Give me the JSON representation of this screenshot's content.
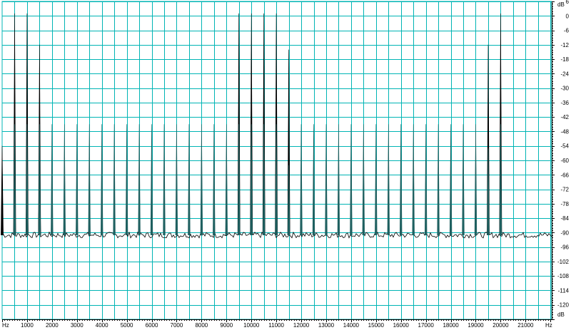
{
  "colors": {
    "grid": "#00b4b4",
    "trace": "#000000",
    "peak_fill": "#1f6060",
    "background": "#ffffff"
  },
  "chart_data": {
    "type": "line",
    "title": "",
    "xlabel": "",
    "ylabel": "",
    "x_unit": "Hz",
    "y_unit": "dB",
    "xlim": [
      0,
      22050
    ],
    "ylim": [
      -126,
      6
    ],
    "grid": true,
    "x_ticks": [
      1000,
      2000,
      3000,
      4000,
      5000,
      6000,
      7000,
      8000,
      9000,
      10000,
      11000,
      12000,
      13000,
      14000,
      15000,
      16000,
      17000,
      18000,
      19000,
      20000,
      21000
    ],
    "y_ticks": [
      6,
      0,
      -6,
      -12,
      -18,
      -24,
      -30,
      -36,
      -42,
      -48,
      -54,
      -60,
      -66,
      -72,
      -78,
      -84,
      -90,
      -96,
      -102,
      -108,
      -114,
      -120
    ],
    "noise_floor_db": -91,
    "series": [
      {
        "values": [
          {
            "x": 0,
            "y": -54
          },
          {
            "x": 500,
            "y": 1
          },
          {
            "x": 1000,
            "y": 1
          },
          {
            "x": 1500,
            "y": -12
          },
          {
            "x": 1000,
            "y": -58
          },
          {
            "x": 1500,
            "y": -58
          },
          {
            "x": 9500,
            "y": 1
          },
          {
            "x": 10000,
            "y": 1
          },
          {
            "x": 10500,
            "y": 1
          },
          {
            "x": 11000,
            "y": 1
          },
          {
            "x": 11500,
            "y": -14
          },
          {
            "x": 19500,
            "y": -12
          },
          {
            "x": 20000,
            "y": 1
          }
        ]
      },
      {
        "values": [
          {
            "x": 500,
            "y": -45
          },
          {
            "x": 1000,
            "y": -45
          },
          {
            "x": 1500,
            "y": -45
          },
          {
            "x": 2000,
            "y": -45
          },
          {
            "x": 2500,
            "y": -45
          },
          {
            "x": 3000,
            "y": -45
          },
          {
            "x": 3500,
            "y": -45
          },
          {
            "x": 4000,
            "y": -45
          },
          {
            "x": 4500,
            "y": -45
          },
          {
            "x": 5000,
            "y": -45
          },
          {
            "x": 5500,
            "y": -45
          },
          {
            "x": 6000,
            "y": -45
          },
          {
            "x": 6500,
            "y": -45
          },
          {
            "x": 7000,
            "y": -45
          },
          {
            "x": 7500,
            "y": -45
          },
          {
            "x": 8000,
            "y": -45
          },
          {
            "x": 8500,
            "y": -45
          },
          {
            "x": 9000,
            "y": -45
          },
          {
            "x": 9500,
            "y": -45
          },
          {
            "x": 10000,
            "y": -45
          },
          {
            "x": 10500,
            "y": -45
          },
          {
            "x": 11000,
            "y": -45
          },
          {
            "x": 11500,
            "y": -62
          },
          {
            "x": 12000,
            "y": -45
          },
          {
            "x": 12500,
            "y": -45
          },
          {
            "x": 13000,
            "y": -45
          },
          {
            "x": 13500,
            "y": -45
          },
          {
            "x": 14000,
            "y": -45
          },
          {
            "x": 14500,
            "y": -45
          },
          {
            "x": 15000,
            "y": -45
          },
          {
            "x": 15500,
            "y": -45
          },
          {
            "x": 16000,
            "y": -45
          },
          {
            "x": 16500,
            "y": -45
          },
          {
            "x": 17000,
            "y": -45
          },
          {
            "x": 17500,
            "y": -45
          },
          {
            "x": 18000,
            "y": -45
          },
          {
            "x": 18500,
            "y": -45
          },
          {
            "x": 19000,
            "y": -45
          },
          {
            "x": 19500,
            "y": -55
          },
          {
            "x": 20000,
            "y": -45
          }
        ]
      }
    ]
  }
}
